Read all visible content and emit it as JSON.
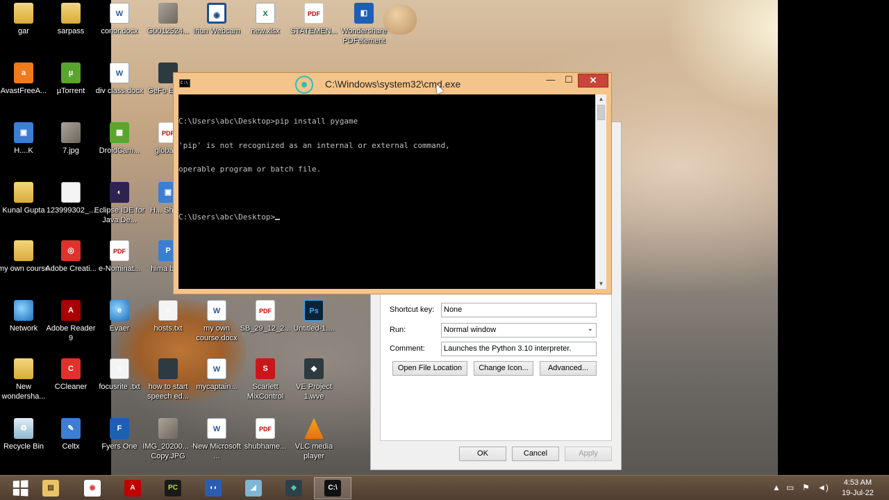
{
  "desktop": {
    "icons": [
      {
        "label": "gar",
        "glyph": ""
      },
      {
        "label": "sarpass",
        "glyph": ""
      },
      {
        "label": "conor.docx",
        "glyph": "W"
      },
      {
        "label": "G0012524...",
        "glyph": ""
      },
      {
        "label": "Iriun Webcam",
        "glyph": "◉"
      },
      {
        "label": "new.xlsx",
        "glyph": "X"
      },
      {
        "label": "STATEMEN...",
        "glyph": "PDF"
      },
      {
        "label": "Wondershare PDFelement",
        "glyph": "◧"
      },
      {
        "label": "AvastFreeA...",
        "glyph": "a"
      },
      {
        "label": "µTorrent",
        "glyph": "µ"
      },
      {
        "label": "div class.docx",
        "glyph": "W"
      },
      {
        "label": "GeFo Exper",
        "glyph": ""
      },
      {
        "label": "H....K",
        "glyph": "▣"
      },
      {
        "label": "7.jpg",
        "glyph": ""
      },
      {
        "label": "DroidCam...",
        "glyph": "▦"
      },
      {
        "label": "global...",
        "glyph": "PDF"
      },
      {
        "label": "Kunal Gupta",
        "glyph": ""
      },
      {
        "label": "123999302_...",
        "glyph": ""
      },
      {
        "label": "Eclipse IDE for Java De...",
        "glyph": "◐"
      },
      {
        "label": "H... Shortc",
        "glyph": "▣"
      },
      {
        "label": "my own course",
        "glyph": ""
      },
      {
        "label": "Adobe Creati...",
        "glyph": "◎"
      },
      {
        "label": "e-Nominat...",
        "glyph": "PDF"
      },
      {
        "label": "hima bill.p",
        "glyph": "P"
      },
      {
        "label": "Network",
        "glyph": ""
      },
      {
        "label": "Adobe Reader 9",
        "glyph": "A"
      },
      {
        "label": "Evaer",
        "glyph": "e"
      },
      {
        "label": "hosts.txt",
        "glyph": "≡"
      },
      {
        "label": "my own course.docx",
        "glyph": "W"
      },
      {
        "label": "SB_29_12_2...",
        "glyph": "PDF"
      },
      {
        "label": "Untitled-1....",
        "glyph": "Ps"
      },
      {
        "label": "New wondersha...",
        "glyph": ""
      },
      {
        "label": "CCleaner",
        "glyph": "C"
      },
      {
        "label": "focusrite .txt",
        "glyph": "≡"
      },
      {
        "label": "how to start speech ed...",
        "glyph": ""
      },
      {
        "label": "mycaptain...",
        "glyph": "W"
      },
      {
        "label": "Scarlett MixControl",
        "glyph": "S"
      },
      {
        "label": "VE Project 1.wve",
        "glyph": "◆"
      },
      {
        "label": "Recycle Bin",
        "glyph": "♻"
      },
      {
        "label": "Celtx",
        "glyph": "✎"
      },
      {
        "label": "Fyers One",
        "glyph": "F"
      },
      {
        "label": "IMG_20200... - Copy.JPG",
        "glyph": ""
      },
      {
        "label": "New Microsoft ...",
        "glyph": "W"
      },
      {
        "label": "shubhame...",
        "glyph": "PDF"
      },
      {
        "label": "VLC media player",
        "glyph": ""
      }
    ]
  },
  "cmd_window": {
    "title": "C:\\Windows\\system32\\cmd.exe",
    "icon_text": "C:\\",
    "minimize": "—",
    "maximize": "☐",
    "close": "✕",
    "console_lines": [
      "C:\\Users\\abc\\Desktop>pip install pygame",
      "'pip' is not recognized as an internal or external command,",
      "operable program or batch file.",
      "",
      "C:\\Users\\abc\\Desktop>"
    ],
    "scroll_up": "▲",
    "scroll_down": "▼"
  },
  "properties_dialog": {
    "shortcut_key_label": "Shortcut key:",
    "shortcut_key_value": "None",
    "run_label": "Run:",
    "run_value": "Normal window",
    "run_arrow": "⌄",
    "comment_label": "Comment:",
    "comment_value": "Launches the Python 3.10 interpreter.",
    "open_file_location": "Open File Location",
    "change_icon": "Change Icon...",
    "advanced": "Advanced...",
    "ok": "OK",
    "cancel": "Cancel",
    "apply": "Apply"
  },
  "taskbar": {
    "buttons": [
      {
        "name": "file-explorer",
        "glyph": "▤"
      },
      {
        "name": "chrome",
        "glyph": "◉"
      },
      {
        "name": "acrobat",
        "glyph": "A"
      },
      {
        "name": "pycharm",
        "glyph": "PC"
      },
      {
        "name": "audacity",
        "glyph": "◖◗"
      },
      {
        "name": "eraser",
        "glyph": "◢"
      },
      {
        "name": "filmora",
        "glyph": "◆"
      },
      {
        "name": "cmd",
        "glyph": "C:\\"
      }
    ],
    "tray": {
      "show_hidden": "▲",
      "network": "▭",
      "action_center": "⚑",
      "volume": "◄)"
    },
    "time": "4:53 AM",
    "date": "19-Jul-22"
  },
  "colors": {
    "cmd_frame": "#f4c48a",
    "close_button": "#c7453a",
    "console_bg": "#000000",
    "console_fg": "#c0c0c0",
    "taskbar": "#5a4636"
  }
}
